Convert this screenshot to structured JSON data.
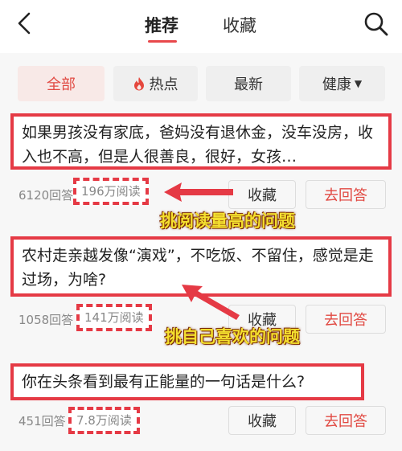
{
  "header": {
    "tabs": [
      {
        "label": "推荐",
        "active": true
      },
      {
        "label": "收藏",
        "active": false
      }
    ]
  },
  "filters": [
    {
      "label": "全部",
      "active": true
    },
    {
      "label": "热点",
      "icon": "fire-icon"
    },
    {
      "label": "最新"
    },
    {
      "label": "健康",
      "icon": "caret-down-icon"
    }
  ],
  "questions": [
    {
      "title": "如果男孩没有家底，爸妈没有退休金，没车没房，收入也不高，但是人很善良，很好，女孩…",
      "answers": "6120回答",
      "reads": "196万阅读",
      "collect_label": "收藏",
      "answer_label": "去回答"
    },
    {
      "title": "农村走亲越发像“演戏”，不吃饭、不留住，感觉是走过场，为啥?",
      "answers": "1058回答",
      "reads": "141万阅读",
      "collect_label": "收藏",
      "answer_label": "去回答"
    },
    {
      "title": "你在头条看到最有正能量的一句话是什么?",
      "answers": "451回答",
      "reads": "7.8万阅读",
      "collect_label": "收藏",
      "answer_label": "去回答"
    }
  ],
  "annotations": {
    "tip1": "挑阅读量高的问题",
    "tip2": "挑自己喜欢的问题"
  },
  "colors": {
    "accent": "#e14a43",
    "highlight_border": "#e53a45",
    "annotation_text": "#f4e02f"
  }
}
